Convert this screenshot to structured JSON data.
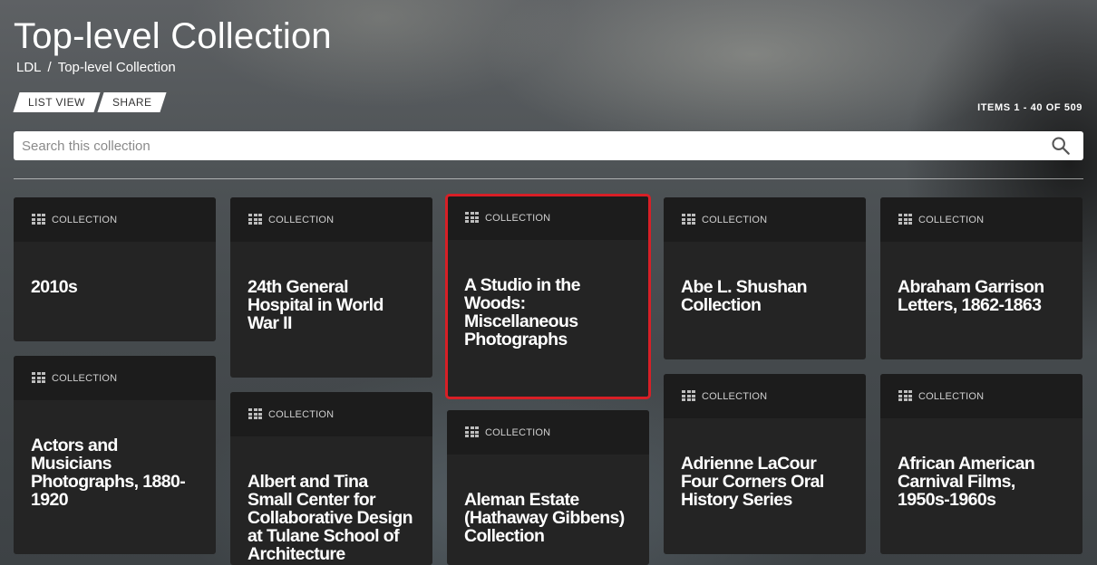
{
  "header": {
    "title": "Top-level Collection",
    "breadcrumb": {
      "root": "LDL",
      "separator": "/",
      "current": "Top-level Collection"
    }
  },
  "toolbar": {
    "list_view_label": "LIST VIEW",
    "share_label": "SHARE",
    "items_count": "ITEMS 1 - 40 OF 509"
  },
  "search": {
    "placeholder": "Search this collection",
    "value": "",
    "icon": "search-icon"
  },
  "card_type_icon": "grid-icon",
  "cards": [
    {
      "type": "COLLECTION",
      "title": "2010s"
    },
    {
      "type": "COLLECTION",
      "title": "24th General Hospital in World War II"
    },
    {
      "type": "COLLECTION",
      "title": "A Studio in the Woods: Miscellaneous Photographs"
    },
    {
      "type": "COLLECTION",
      "title": "Abe L. Shushan Collection"
    },
    {
      "type": "COLLECTION",
      "title": "Abraham Garrison Letters, 1862-1863"
    },
    {
      "type": "COLLECTION",
      "title": "Actors and Musicians Photographs, 1880-1920"
    },
    {
      "type": "COLLECTION",
      "title": "Albert and Tina Small Center for Collaborative Design at Tulane School of Architecture"
    },
    {
      "type": "COLLECTION",
      "title": "Aleman Estate (Hathaway Gibbens) Collection"
    },
    {
      "type": "COLLECTION",
      "title": "Adrienne LaCour Four Corners Oral History Series"
    },
    {
      "type": "COLLECTION",
      "title": "African American Carnival Films, 1950s-1960s"
    }
  ],
  "colors": {
    "card_bg": "#242424",
    "card_header_bg": "#1c1c1c",
    "highlight": "#d81f26"
  }
}
